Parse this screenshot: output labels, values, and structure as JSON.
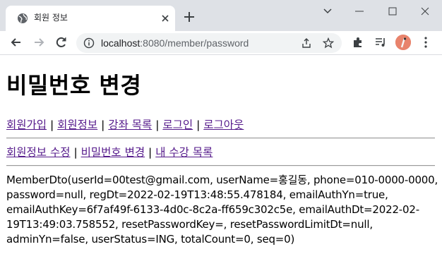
{
  "browser": {
    "tab_title": "회원 정보",
    "url_host": "localhost",
    "url_path": ":8080/member/password"
  },
  "page": {
    "title": "비밀번호 변경",
    "nav_main": [
      {
        "label": "회원가입"
      },
      {
        "label": "회원정보"
      },
      {
        "label": "강좌 목록"
      },
      {
        "label": "로그인"
      },
      {
        "label": "로그아웃"
      }
    ],
    "nav_sub": [
      {
        "label": "회원정보 수정"
      },
      {
        "label": "비밀번호 변경"
      },
      {
        "label": "내 수강 목록"
      }
    ],
    "separator": "|",
    "member_dto_lines": [
      "MemberDto(userId=00test@gmail.com, userName=홍길동, phone=010-0000-0000,",
      "password=null, regDt=2022-02-19T13:48:55.478184, emailAuthYn=true,",
      "emailAuthKey=6f7af49f-6133-4d0c-8c2a-ff659c302c5e, emailAuthDt=2022-02-",
      "19T13:49:03.758552, resetPasswordKey=, resetPasswordLimitDt=null,",
      "adminYn=false, userStatus=ING, totalCount=0, seq=0)"
    ]
  },
  "colors": {
    "link": "#551a8b",
    "tabstrip": "#dee1e6",
    "omnibox": "#f1f3f4"
  }
}
